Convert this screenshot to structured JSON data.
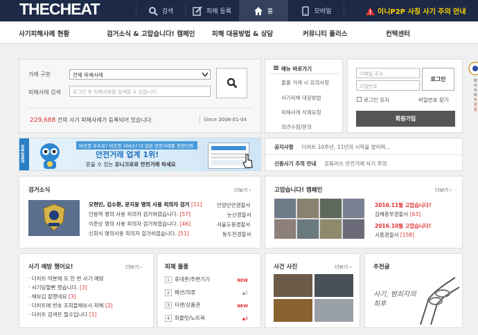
{
  "header": {
    "logo": "THECHEAT",
    "nav": [
      {
        "label": "검색",
        "icon": "search-icon"
      },
      {
        "label": "피해 등록",
        "icon": "edit-icon"
      },
      {
        "label": "홈",
        "icon": "home-icon"
      },
      {
        "label": "모바일",
        "icon": "mobile-icon"
      }
    ],
    "alert": "이니P2P 사칭 사기 주의 안내"
  },
  "menu": [
    "사기피해사례 현황",
    "검거소식 & 고맙습니다! 캠페인",
    "피해 대응방법 & 상담",
    "커뮤니티 폴리스",
    "컨택센터"
  ],
  "search": {
    "type_label": "거래 구분",
    "type_value": "전체 피해사례",
    "query_label": "피해사례 검색",
    "query_placeholder": "로그인 후 피해사례를 검색할 수 있습니다.",
    "count": "229,688",
    "count_suffix": "건의 사기 피해사례가 등록되어 있습니다.",
    "since": "Since 2006-01-04"
  },
  "quick_menu": {
    "title": "메뉴 바로가기",
    "items": [
      "물품 거래 시 유의사항",
      "사기피해 대응방법",
      "피해사례 삭제요청",
      "의견수렴/문의"
    ]
  },
  "login": {
    "email_placeholder": "이메일 주소",
    "password_placeholder": "비밀번호",
    "login_button": "로그인",
    "keep_login": "로그인 유지",
    "find_password": "비밀번호 찾기",
    "join_button": "회원가입"
  },
  "banner": {
    "tag": "UNICRO",
    "line1": "비슷한 수수료? 비슷한 서비스? 더 많은 안전거래를 원한다면,",
    "line2": "안전거래 업계 1위!",
    "line3_pre": "믿을 수 있는 ",
    "line3_brand": "유니크로",
    "line3_post": "로 안전거래 하세요"
  },
  "notices": [
    {
      "label": "공지사항",
      "text": "더치트 10주년, 11년의 시작을 알리며..."
    },
    {
      "label": "신종사기 주의 안내",
      "text": "유튜러스 안전거래 사기 주의"
    }
  ],
  "arrest_news": {
    "title": "검거소식",
    "more": "더보기",
    "items": [
      {
        "text": "오현민, 김수환, 문지웅 명의 사용 피의자 검거",
        "count": "[11]",
        "source": "안양만안경찰서"
      },
      {
        "text": "안용혁 명의 사용 피의자 검거하였습니다.",
        "count": "[57]",
        "source": "논산경찰서"
      },
      {
        "text": "이준상 명의 사용 피의자 검거하였습니다.",
        "count": "[46]",
        "source": "서울도봉경찰서"
      },
      {
        "text": "신희식 명의사용 피의자 검거하였습니다.",
        "count": "[51]",
        "source": "동두천경찰서"
      }
    ]
  },
  "thanks_campaign": {
    "title": "고맙습니다! 캠페인",
    "more": "더보기",
    "items": [
      {
        "date": "2016.11월",
        "headline": "고맙습니다!",
        "org": "김해중부경찰서",
        "count": "[63]"
      },
      {
        "date": "2016.10월",
        "headline": "고맙습니다!",
        "org": "시흥경찰서",
        "count": "[158]"
      }
    ]
  },
  "prevention": {
    "title": "사기 예방 했어요!",
    "more": "더보기",
    "items": [
      {
        "text": "더치트 덕분에 또 한 번 사기 예방",
        "count": ""
      },
      {
        "text": "사기당할뻔 했습니다.",
        "count": "[3]"
      },
      {
        "text": "해보김 잘했네요",
        "count": "[3]"
      },
      {
        "text": "더치트에 번호 조회들해보시 피해",
        "count": "[2]"
      },
      {
        "text": "더치트 검색은 필수입니다",
        "count": "[1]"
      }
    ]
  },
  "victim_items": {
    "title": "피해 물품",
    "items": [
      {
        "rank": "1",
        "name": "휴대폰/주변기기",
        "badge": "NEW"
      },
      {
        "rank": "2",
        "name": "패션/의류",
        "badge": "▲2"
      },
      {
        "rank": "3",
        "name": "티켓/상품권",
        "badge": "NEW"
      },
      {
        "rank": "4",
        "name": "화물릿/노트북",
        "badge": "▲6"
      }
    ]
  },
  "photos": {
    "title": "사건 사진",
    "more": "더보기"
  },
  "recommend": {
    "title": "추천글",
    "caption": "사기, 범죄자의 최후"
  },
  "side_ad": {
    "line1": "대",
    "line2": "사이버",
    "line3": "주 경찰"
  },
  "colors": {
    "navy": "#1c2a47",
    "accent_red": "#e03030",
    "alert_yellow": "#ffd200"
  }
}
